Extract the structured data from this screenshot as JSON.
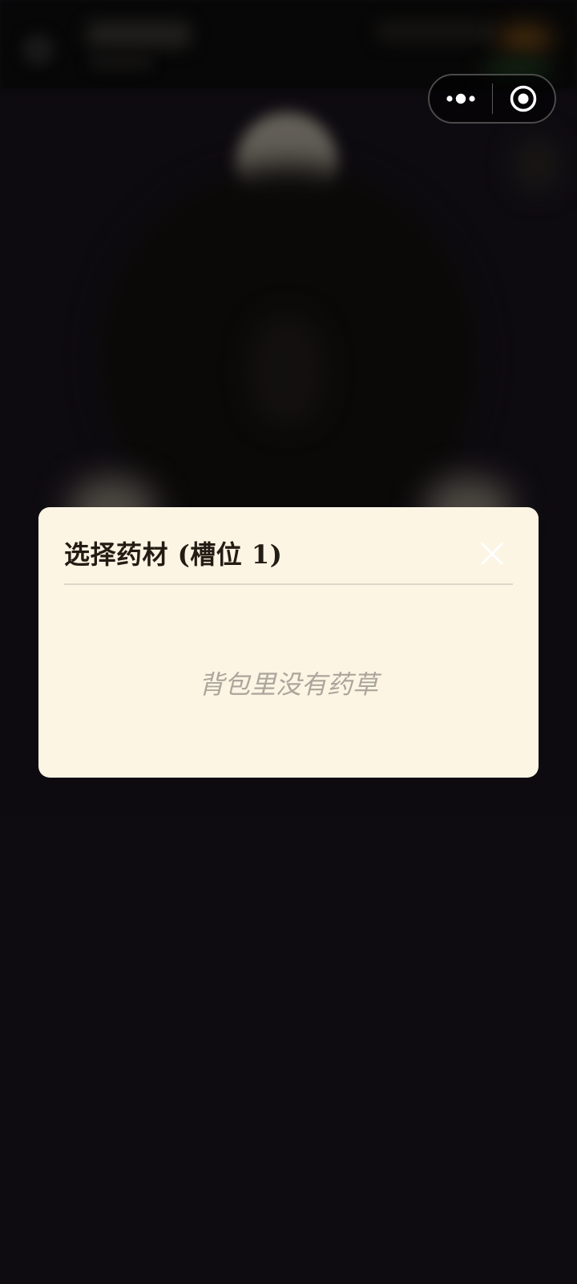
{
  "modal": {
    "title": "选择药材 (槽位 1)",
    "empty_message": "背包里没有药草",
    "close_icon": "close-icon"
  },
  "capsule": {
    "more_icon": "more-dots-icon",
    "close_icon": "target-circle-icon"
  },
  "colors": {
    "modal_bg": "#fcf5e4",
    "title_text": "#231c14",
    "empty_text": "#aba69c",
    "page_bg": "#141017"
  }
}
